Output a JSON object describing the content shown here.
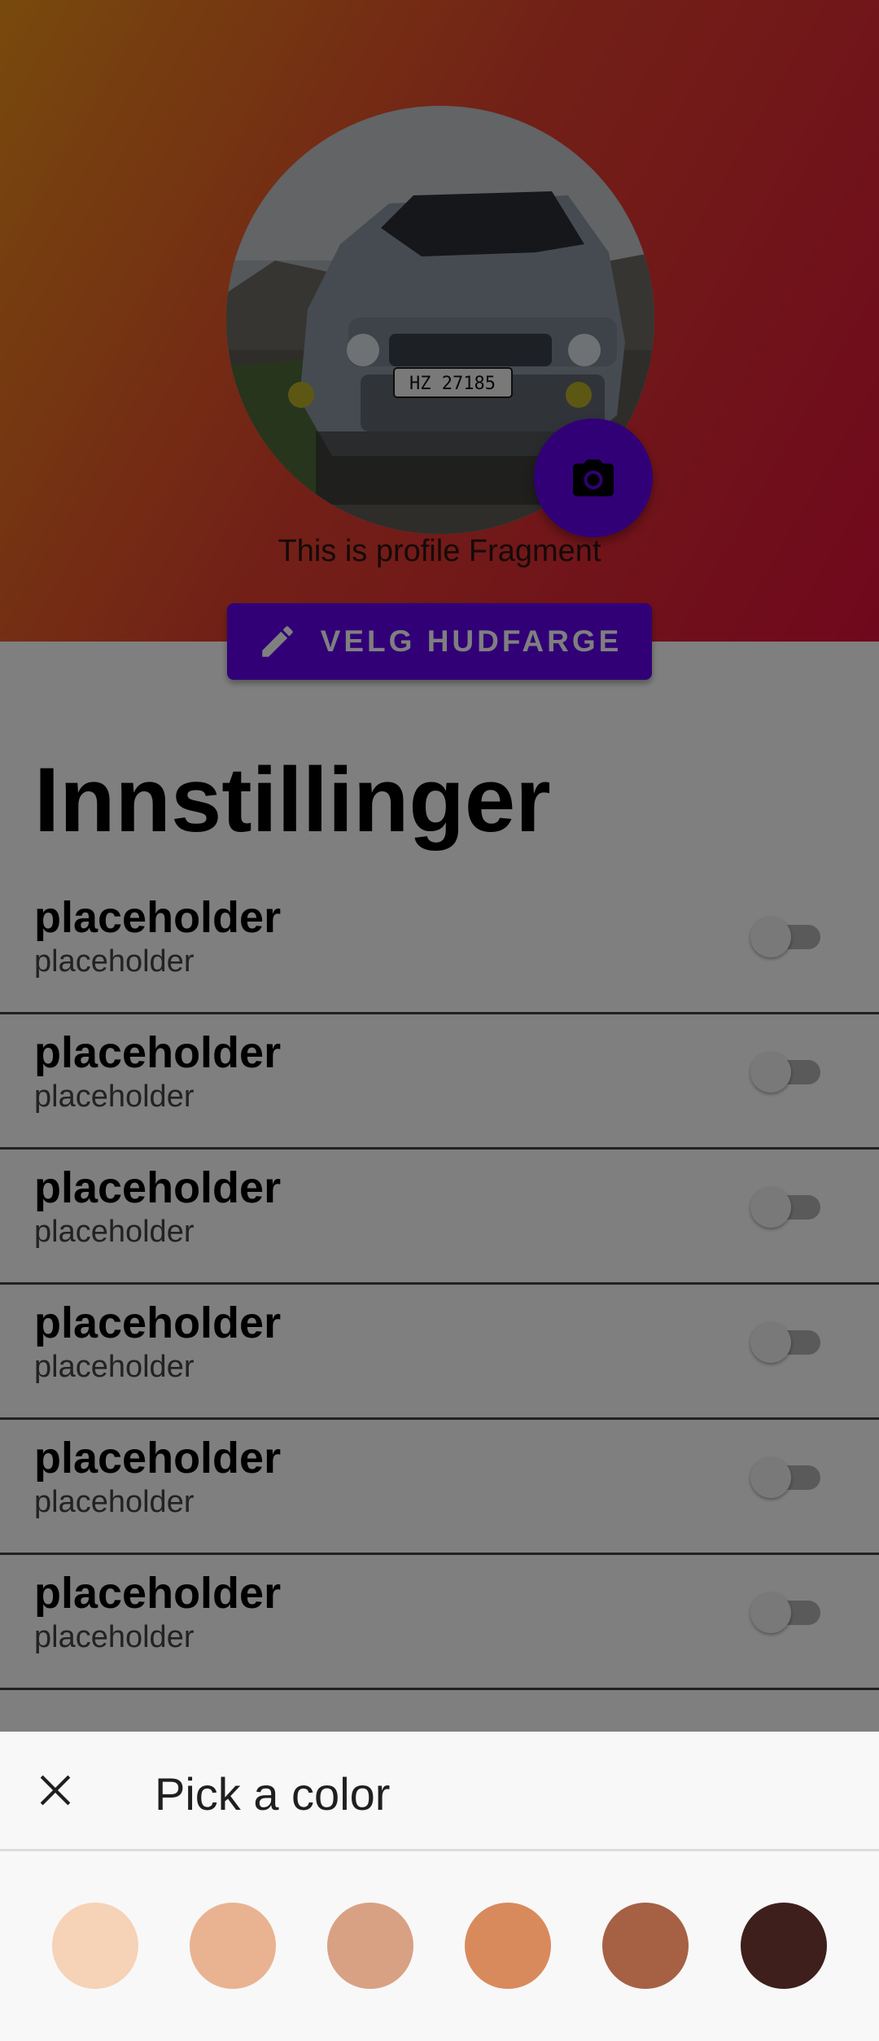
{
  "profile": {
    "caption": "This is profile Fragment",
    "avatar_plate_text": "HZ 27185",
    "camera_icon": "camera-icon"
  },
  "color_button": {
    "label": "VELG HUDFARGE",
    "icon": "pencil-icon",
    "color": "#6200ee"
  },
  "settings": {
    "title": "Innstillinger",
    "items": [
      {
        "title": "placeholder",
        "subtitle": "placeholder",
        "enabled": false
      },
      {
        "title": "placeholder",
        "subtitle": "placeholder",
        "enabled": false
      },
      {
        "title": "placeholder",
        "subtitle": "placeholder",
        "enabled": false
      },
      {
        "title": "placeholder",
        "subtitle": "placeholder",
        "enabled": false
      },
      {
        "title": "placeholder",
        "subtitle": "placeholder",
        "enabled": false
      },
      {
        "title": "placeholder",
        "subtitle": "placeholder",
        "enabled": false
      }
    ]
  },
  "color_sheet": {
    "title": "Pick a color",
    "close_icon": "close-icon",
    "swatches": [
      "#f6d2b7",
      "#e9b392",
      "#d8a184",
      "#d98a5c",
      "#a66044",
      "#3e1f1c"
    ]
  }
}
